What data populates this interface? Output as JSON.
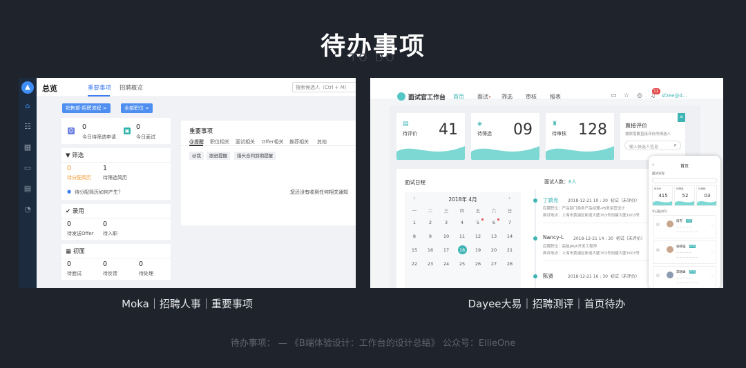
{
  "slide": {
    "title": "待办事项",
    "subtitle": "TO DO",
    "footer": "待办事项： — 《B端体验设计：工作台的设计总结》 公众号：EllieOne"
  },
  "moka": {
    "caption": "Moka｜招聘人事｜重要事项",
    "page_title": "总览",
    "tabs": [
      "重要事项",
      "招聘概览"
    ],
    "search_placeholder": "搜索候选人（Ctrl + M）",
    "filter_buttons": [
      "销售部-招聘流程 >",
      "全部职位 >"
    ],
    "overview": [
      {
        "value": "0",
        "label": "今日待筛选申请"
      },
      {
        "value": "0",
        "label": "今日面试"
      }
    ],
    "screening": {
      "title": "筛选",
      "items": [
        {
          "value": "0",
          "label": "待分配简历"
        },
        {
          "value": "1",
          "label": "待筛选简历"
        }
      ],
      "hint": "待分配简历如何产生？"
    },
    "hire": {
      "title": "录用",
      "items": [
        {
          "value": "0",
          "label": "待发送Offer"
        },
        {
          "value": "0",
          "label": "待入职"
        }
      ]
    },
    "interview": {
      "title": "初面",
      "items": [
        {
          "value": "0",
          "label": "待面试"
        },
        {
          "value": "0",
          "label": "待反馈"
        },
        {
          "value": "0",
          "label": "待处理"
        }
      ]
    },
    "important": {
      "title": "重要事项",
      "tabs": [
        "@提醒",
        "职位相关",
        "面试相关",
        "Offer相关",
        "推荐相关",
        "其他"
      ],
      "chips": [
        "@我",
        "跟进提醒",
        "猎头合同到期提醒"
      ],
      "empty": "您还没有收到任何相关通知"
    },
    "colors": {
      "sidebar": "#1d2b3e",
      "accent": "#3e7cf0",
      "warning": "#f39a31"
    }
  },
  "dayee": {
    "caption": "Dayee大易｜招聘测评｜首页待办",
    "app_title": "面试官工作台",
    "nav": [
      "首页",
      "面试",
      "筛选",
      "审核",
      "报表"
    ],
    "badge": "12",
    "user": "sfzee@d...",
    "stats": [
      {
        "label": "待评价",
        "value": "41"
      },
      {
        "label": "待筛选",
        "value": "09"
      },
      {
        "label": "待审核",
        "value": "128"
      }
    ],
    "direct_eval": {
      "title": "直接评价",
      "desc": "搜索需要直接评价的候选人",
      "placeholder": "输入候选人信息"
    },
    "schedule": {
      "title": "面试日程",
      "month": "2018年 4月",
      "weekdays": [
        "一",
        "二",
        "三",
        "四",
        "五",
        "六",
        "日"
      ],
      "days": [
        "1",
        "2",
        "3",
        "4",
        "5",
        "6",
        "7",
        "8",
        "9",
        "10",
        "11",
        "12",
        "13",
        "14",
        "15",
        "16",
        "17",
        "18",
        "19",
        "20",
        "21",
        "22",
        "23",
        "24",
        "25",
        "26",
        "27",
        "28"
      ],
      "today": "18",
      "marked": [
        "5",
        "6"
      ]
    },
    "interview_count_label": "面试人数：",
    "interview_count": "6人",
    "interviews": [
      {
        "name": "丁鹏克",
        "time": "2018-12-21  10 : 30",
        "round": "初试（未评价）",
        "position": "应聘职位：产品部门商务产品经理-P8来运营设计",
        "place": "面试地点：上海市黄浦区新谊大厦763号创建大厦1603号"
      },
      {
        "name": "Nancy-L",
        "time": "2018-12-21  14 : 30",
        "round": "初试（未评价）",
        "position": "应聘职位：高级JAVA开发工程师",
        "place": "面试地点：上海市黄浦区新谊大厦763号创建大厦1603号"
      },
      {
        "name": "陈贤",
        "time": "2018-12-21  16 : 30",
        "round": "初试（未评价）",
        "position": "",
        "place": ""
      }
    ],
    "mobile": {
      "title": "首页",
      "section": "面试日程",
      "stats": [
        {
          "label": "待评价",
          "value": "415"
        },
        {
          "label": "待筛选",
          "value": "52"
        },
        {
          "label": "待审核",
          "value": "03"
        }
      ],
      "list_title": "今日面试(5)",
      "candidates": [
        {
          "name": "周杰",
          "tag": "初试"
        },
        {
          "name": "张晓强",
          "tag": "初试"
        },
        {
          "name": "李晓峰",
          "tag": "初试"
        }
      ]
    },
    "colors": {
      "accent": "#3fb4b4",
      "badge": "#e24a4a"
    }
  }
}
